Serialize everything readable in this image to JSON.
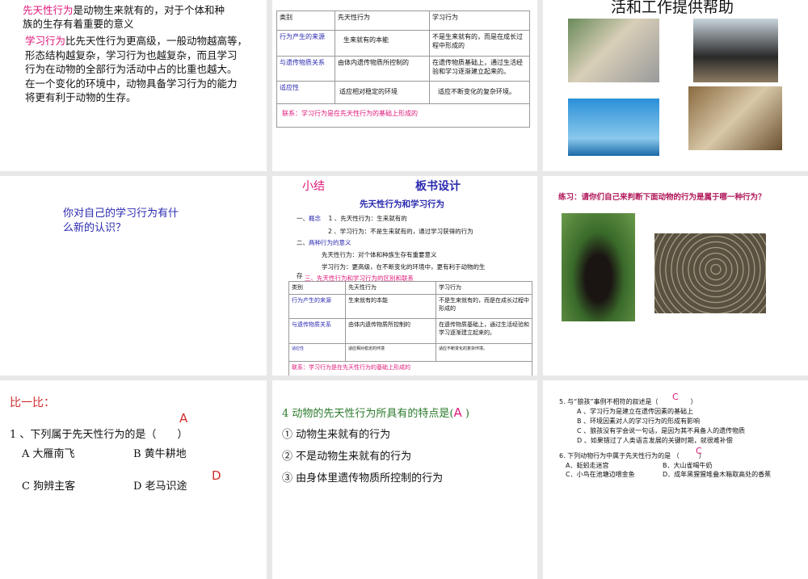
{
  "slide1": {
    "p1_highlight": "先天性行为",
    "p1_rest": "是动物生来就有的，对于个体和种",
    "p1_line2": "族的生存有着重要的意义",
    "p2_highlight": "学习行为",
    "p2_line1": "比先天性行为更高级，一般动物越高等，",
    "p2_lines": [
      "形态结构越复杂，学习行为也越复杂，而且学习",
      "行为在动物的全部行为活动中占的比重也越大。",
      "在一个变化的环境中，动物具备学习行为的能力",
      "将更有利于动物的生存。"
    ]
  },
  "table": {
    "headers": [
      "类别",
      "先天性行为",
      "学习行为"
    ],
    "rows": [
      [
        "行为产生的来源",
        "生来就有的本能",
        "不是生来就有的，而是在成长过程中形成的"
      ],
      [
        "与遗传物质关系",
        "由体内遗传物质所控制的",
        "在遗传物质基础上，通过生活经验和学习逐渐建立起来的。"
      ],
      [
        "适应性",
        "适应相对稳定的环境",
        "适应不断变化的复杂环境。"
      ]
    ],
    "footer": "联系：学习行为是在先天性行为的基础上形成的"
  },
  "slide3": {
    "title": "活和工作提供帮助"
  },
  "slide4": {
    "line1": "你对自己的学习行为有什",
    "line2": "么新的认识？"
  },
  "slide5": {
    "summary": "小结",
    "board": "板书设计",
    "title": "先天性行为和学习行为",
    "s1": "一、",
    "s1b": "概念",
    "s1c": "1 、先天性行为：生来就有的",
    "s1d": "2 、学习行为：不是生来就有的，通过学习获得的行为",
    "s2": "二、",
    "s2b": "两种行为的意义",
    "s2c": "先天性行为：对个体和种族生存有重要意义",
    "s2d": "学习行为：更高级，在不断变化的环境中，更有利于动物的生",
    "s2e": "存",
    "s3": "三、先天性行为和学习行为的区别和联系"
  },
  "slide6": {
    "title": "练习：请你们自己来判断下面动物的行为是属于哪一种行为？"
  },
  "slide7": {
    "heading": "比一比：",
    "answer1": "A",
    "question": "1 、下列属于先天性行为的是（　　）",
    "optA": "A 大雁南飞",
    "optB": "B 黄牛耕地",
    "optC": "C 狗辨主客",
    "optD": "D 老马识途",
    "answer2": "D"
  },
  "slide8": {
    "question": "4  动物的先天性行为所具有的特点是(",
    "answer": "A",
    "close": " )",
    "items": [
      "① 动物生来就有的行为",
      "② 不是动物生来就有的行为",
      "③ 由身体里遗传物质所控制的行为"
    ]
  },
  "slide9": {
    "q5": "5. 与“狼孩”事例不相符的叙述是（　　　　　）",
    "a5": "C",
    "q5opts": [
      "A 、学习行为是建立在遗传因素的基础上",
      "B 、环境因素对人的学习行为的形成有影响",
      "C 、狼孩没有学会说一句话，是因为其不具备人的遗传物质",
      "D 、如果错过了人类语言发展的关键时期，就很难补偿"
    ],
    "q6": "6. 下列动物行为中属于先天性行为的是 （　　　）",
    "a6": "C",
    "q6opts": [
      "A．蚯蚓走迷宫",
      "B．大山雀喝牛奶",
      "C．小鸟在池塘边喂金鱼",
      "D．成年黑猩猩堆叠木箱取高处的香蕉"
    ]
  }
}
